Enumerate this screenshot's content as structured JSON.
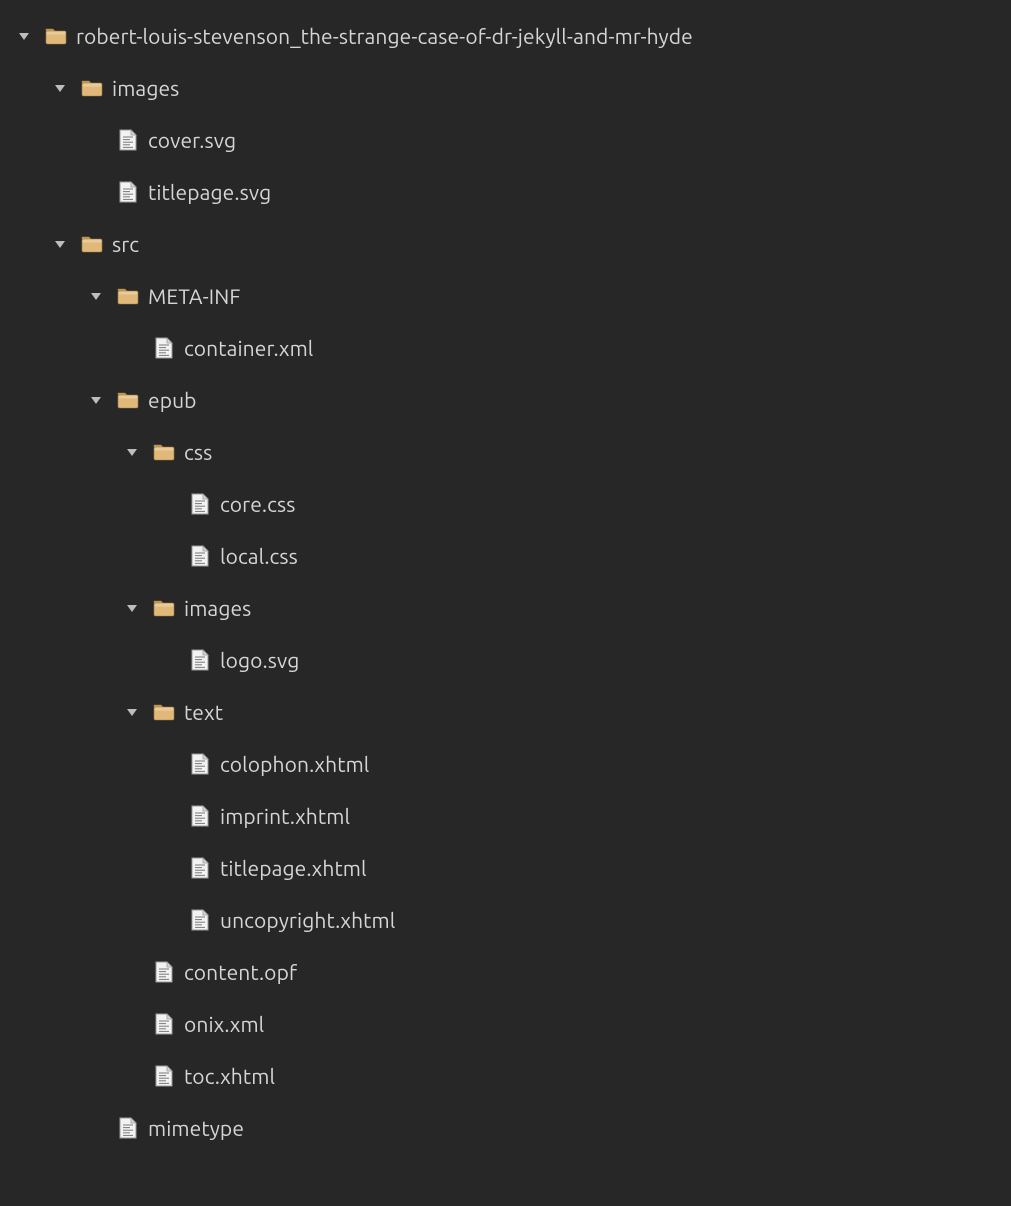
{
  "colors": {
    "background": "#272727",
    "text": "#d6d6d6",
    "arrow": "#bdbdbd",
    "folder_fill": "#e0b97a",
    "folder_tab": "#caa15f",
    "folder_stroke": "#9e7a3e",
    "file_fill": "#f2f2f2",
    "file_stroke": "#9a9a9a",
    "file_lines": "#7a7a7a"
  },
  "tree": [
    {
      "depth": 0,
      "kind": "folder",
      "expanded": true,
      "label": "robert-louis-stevenson_the-strange-case-of-dr-jekyll-and-mr-hyde"
    },
    {
      "depth": 1,
      "kind": "folder",
      "expanded": true,
      "label": "images"
    },
    {
      "depth": 2,
      "kind": "file",
      "label": "cover.svg"
    },
    {
      "depth": 2,
      "kind": "file",
      "label": "titlepage.svg"
    },
    {
      "depth": 1,
      "kind": "folder",
      "expanded": true,
      "label": "src"
    },
    {
      "depth": 2,
      "kind": "folder",
      "expanded": true,
      "label": "META-INF"
    },
    {
      "depth": 3,
      "kind": "file",
      "label": "container.xml"
    },
    {
      "depth": 2,
      "kind": "folder",
      "expanded": true,
      "label": "epub"
    },
    {
      "depth": 3,
      "kind": "folder",
      "expanded": true,
      "label": "css"
    },
    {
      "depth": 4,
      "kind": "file",
      "label": "core.css"
    },
    {
      "depth": 4,
      "kind": "file",
      "label": "local.css"
    },
    {
      "depth": 3,
      "kind": "folder",
      "expanded": true,
      "label": "images"
    },
    {
      "depth": 4,
      "kind": "file",
      "label": "logo.svg"
    },
    {
      "depth": 3,
      "kind": "folder",
      "expanded": true,
      "label": "text"
    },
    {
      "depth": 4,
      "kind": "file",
      "label": "colophon.xhtml"
    },
    {
      "depth": 4,
      "kind": "file",
      "label": "imprint.xhtml"
    },
    {
      "depth": 4,
      "kind": "file",
      "label": "titlepage.xhtml"
    },
    {
      "depth": 4,
      "kind": "file",
      "label": "uncopyright.xhtml"
    },
    {
      "depth": 3,
      "kind": "file",
      "label": "content.opf"
    },
    {
      "depth": 3,
      "kind": "file",
      "label": "onix.xml"
    },
    {
      "depth": 3,
      "kind": "file",
      "label": "toc.xhtml"
    },
    {
      "depth": 2,
      "kind": "file",
      "label": "mimetype"
    }
  ]
}
